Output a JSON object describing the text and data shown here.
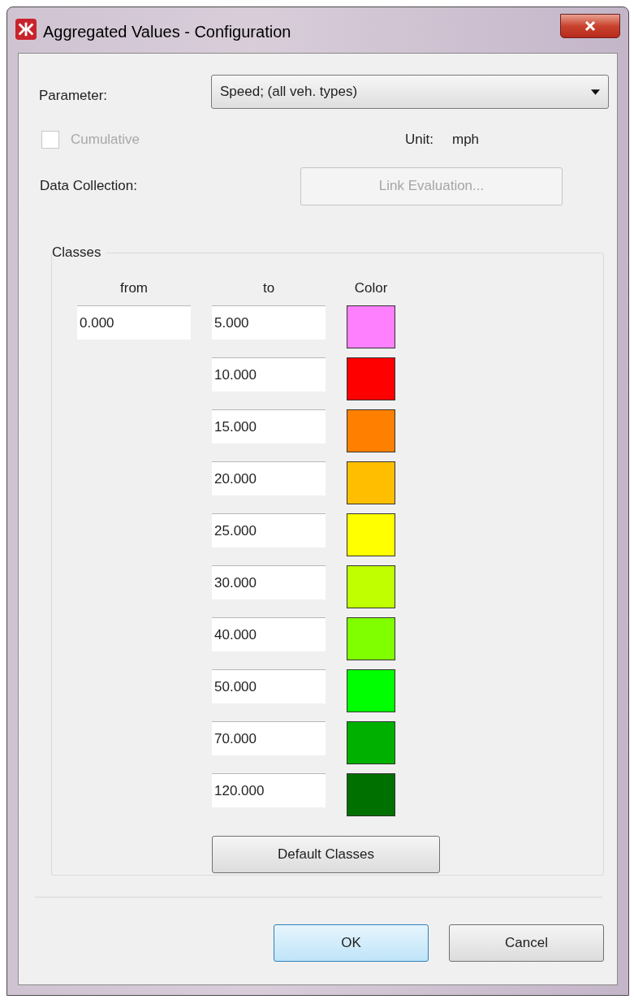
{
  "window": {
    "title": "Aggregated Values - Configuration"
  },
  "parameter": {
    "label": "Parameter:",
    "value": "Speed; (all veh. types)"
  },
  "cumulative": {
    "label": "Cumulative",
    "checked": false,
    "disabled": true
  },
  "unit": {
    "label": "Unit:",
    "value": "mph"
  },
  "data_collection": {
    "label": "Data Collection:",
    "button": "Link Evaluation...",
    "disabled": true
  },
  "classes": {
    "title": "Classes",
    "columns": [
      "from",
      "to",
      "Color"
    ],
    "rows": [
      {
        "from": "0.000",
        "to": "5.000",
        "color": "#ff80ff"
      },
      {
        "to": "10.000",
        "color": "#ff0000"
      },
      {
        "to": "15.000",
        "color": "#ff8000"
      },
      {
        "to": "20.000",
        "color": "#ffbf00"
      },
      {
        "to": "25.000",
        "color": "#ffff00"
      },
      {
        "to": "30.000",
        "color": "#bfff00"
      },
      {
        "to": "40.000",
        "color": "#80ff00"
      },
      {
        "to": "50.000",
        "color": "#00ff00"
      },
      {
        "to": "70.000",
        "color": "#00b000"
      },
      {
        "to": "120.000",
        "color": "#007000"
      }
    ],
    "default_button": "Default Classes"
  },
  "buttons": [
    {
      "label": "OK",
      "default": true
    },
    {
      "label": "Cancel",
      "default": false
    }
  ]
}
